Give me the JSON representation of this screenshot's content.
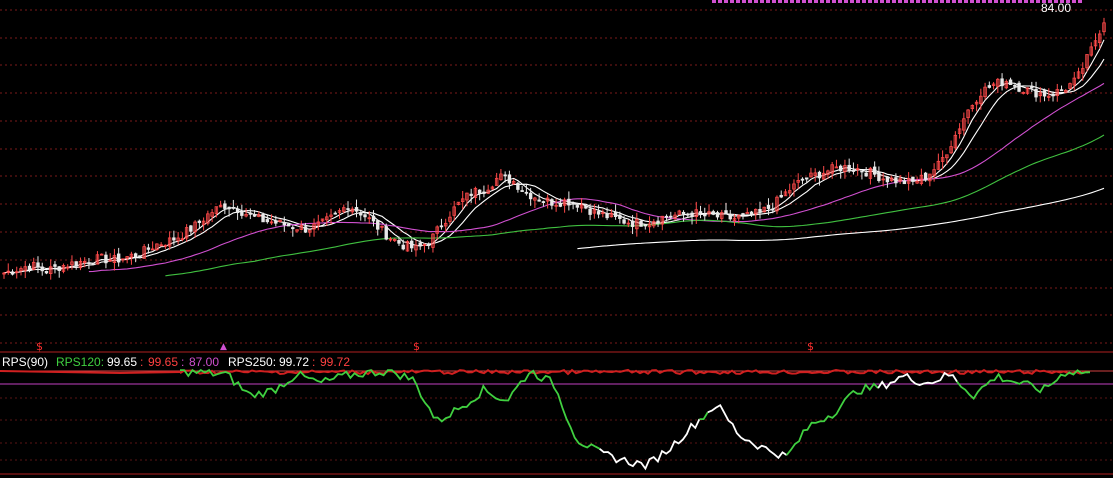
{
  "price_panel": {
    "price_label": "84.00",
    "candle_up_color": "#ff4a4a",
    "candle_down_color": "#e8e8e8"
  },
  "rps_panel": {
    "indicator_name": "RPS(90)",
    "rps120_label": "RPS120:",
    "rps120_value": "99.65",
    "rps120_value2": "99.65",
    "rps120_value3": "87.00",
    "rps250_label": "RPS250:",
    "rps250_value": "99.72",
    "rps250_value2": "99.72",
    "signal_marker": "$",
    "buy_marker": "▲"
  },
  "colors": {
    "background": "#000000",
    "ma_short": "#ffffff",
    "ma_mid": "#ffffff",
    "ma_long_magenta": "#d050d0",
    "ma_green": "#40c040",
    "ma_year": "#ffffff",
    "rps_green": "#40d040",
    "rps_red": "#d02020",
    "rps_white": "#ffffff",
    "grid": "#a02020"
  },
  "chart_data": [
    {
      "type": "candlestick",
      "title": "",
      "y_reference": 84.0,
      "series": [
        {
          "name": "price",
          "shape": [
            0.7,
            0.75,
            0.8,
            0.72,
            0.78,
            0.82,
            0.85,
            0.88,
            0.86,
            0.9,
            0.95,
            1.05,
            1.1,
            1.18,
            1.3,
            1.45,
            1.55,
            1.5,
            1.4,
            1.35,
            1.32,
            1.28,
            1.25,
            1.3,
            1.4,
            1.55,
            1.45,
            1.3,
            1.15,
            1.05,
            1.0,
            1.1,
            1.35,
            1.55,
            1.7,
            1.75,
            1.9,
            1.85,
            1.7,
            1.62,
            1.58,
            1.6,
            1.55,
            1.45,
            1.4,
            1.35,
            1.32,
            1.35,
            1.4,
            1.42,
            1.45,
            1.42,
            1.4,
            1.38,
            1.4,
            1.45,
            1.55,
            1.72,
            1.85,
            1.92,
            1.98,
            2.02,
            2.0,
            1.95,
            1.88,
            1.85,
            1.82,
            1.9,
            2.05,
            2.35,
            2.7,
            2.95,
            3.05,
            3.1,
            3.0,
            2.95,
            2.92,
            2.98,
            3.1,
            3.45,
            3.85
          ]
        }
      ],
      "ma_lines": [
        "MA-short",
        "MA-mid",
        "MA-magenta",
        "MA-green",
        "MA-year"
      ]
    },
    {
      "type": "line",
      "title": "RPS(90)",
      "ylim": [
        0,
        100
      ],
      "series": [
        {
          "name": "RPS120",
          "values": [
            99,
            98,
            97,
            85,
            88,
            97,
            92,
            96,
            98,
            99,
            94,
            70,
            78,
            88,
            82,
            99,
            92,
            60,
            52,
            48,
            45,
            55,
            68,
            80,
            62,
            55,
            50,
            68,
            75,
            88,
            90,
            96,
            92,
            97,
            85,
            96,
            92,
            88,
            99,
            98
          ]
        },
        {
          "name": "RPS250",
          "values": [
            99,
            99,
            99,
            99,
            99,
            99,
            99,
            99,
            99,
            99,
            99,
            99,
            99,
            99,
            99,
            99,
            99,
            99,
            99,
            99,
            99,
            99,
            99,
            99,
            99,
            99,
            99,
            99,
            99,
            99,
            99,
            99,
            99,
            99,
            99,
            99,
            99,
            99,
            99,
            99
          ]
        }
      ],
      "reference_lines": [
        99.65,
        87.0
      ]
    }
  ]
}
